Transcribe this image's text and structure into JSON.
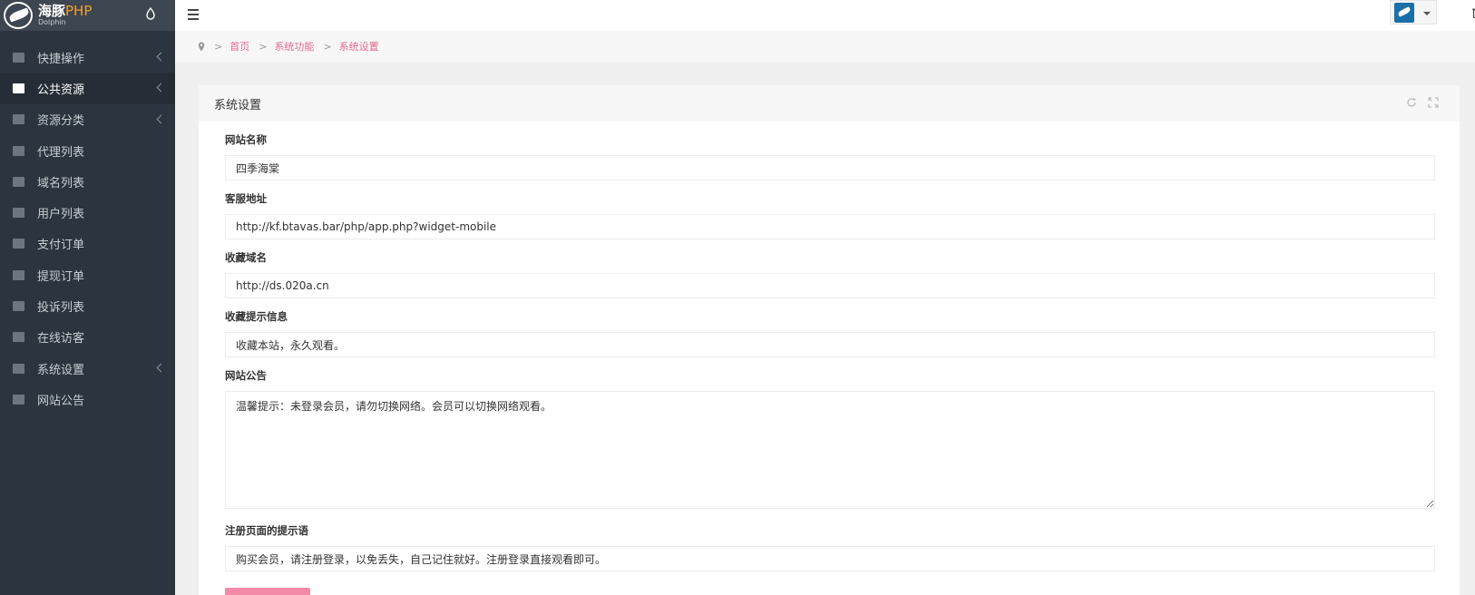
{
  "brand": {
    "name": "海豚",
    "php": "PHP",
    "sub": "Dolphin"
  },
  "sidebar": {
    "items": [
      {
        "label": "快捷操作",
        "icon": "folder-icon",
        "arrow": true,
        "active": false
      },
      {
        "label": "公共资源",
        "icon": "video-camera-icon",
        "arrow": true,
        "active": true
      },
      {
        "label": "资源分类",
        "icon": "grid-icon",
        "arrow": true,
        "active": false
      },
      {
        "label": "代理列表",
        "icon": "users-icon",
        "arrow": false,
        "active": false
      },
      {
        "label": "域名列表",
        "icon": "linkedin-icon",
        "arrow": false,
        "active": false
      },
      {
        "label": "用户列表",
        "icon": "user-icon",
        "arrow": false,
        "active": false
      },
      {
        "label": "支付订单",
        "icon": "database-icon",
        "arrow": false,
        "active": false
      },
      {
        "label": "提现订单",
        "icon": "bank-icon",
        "arrow": false,
        "active": false
      },
      {
        "label": "投诉列表",
        "icon": "warning-icon",
        "arrow": false,
        "active": false
      },
      {
        "label": "在线访客",
        "icon": "globe-icon",
        "arrow": false,
        "active": false
      },
      {
        "label": "系统设置",
        "icon": "gear-icon",
        "arrow": true,
        "active": false
      },
      {
        "label": "网站公告",
        "icon": "bullhorn-icon",
        "arrow": false,
        "active": false
      }
    ]
  },
  "breadcrumb": {
    "items": [
      "首页",
      "系统功能",
      "系统设置"
    ]
  },
  "panel": {
    "title": "系统设置"
  },
  "form": {
    "site_name": {
      "label": "网站名称",
      "value": "四季海棠"
    },
    "service_url": {
      "label": "客服地址",
      "value": "http://kf.btavas.bar/php/app.php?widget-mobile"
    },
    "bookmark_domain": {
      "label": "收藏域名",
      "value": "http://ds.020a.cn"
    },
    "bookmark_tip": {
      "label": "收藏提示信息",
      "value": "收藏本站，永久观看。"
    },
    "site_notice": {
      "label": "网站公告",
      "value": "温馨提示：未登录会员，请勿切换网络。会员可以切换网络观看。"
    },
    "register_tip": {
      "label": "注册页面的提示语",
      "value": "购买会员，请注册登录，以免丢失，自己记住就好。注册登录直接观看即可。"
    }
  },
  "colors": {
    "sidebar_bg": "#2c343f",
    "accent": "#e4698e",
    "submit": "#f28aa8"
  }
}
